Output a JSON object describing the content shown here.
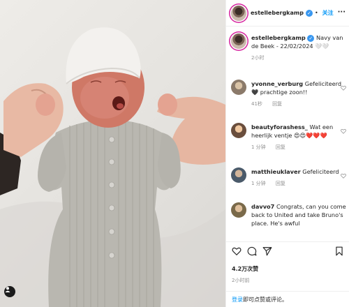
{
  "header": {
    "username": "estellebergkamp",
    "separator": "•",
    "follow_label": "关注",
    "more_label": "···"
  },
  "caption": {
    "username": "estellebergkamp",
    "text": "Navy van de Beek - 22/02/2024 🤍🤍",
    "time": "2小时"
  },
  "comments": [
    {
      "username": "yvonne_verburg",
      "text": "Gefeliciteerd 🖤 prachtige zoon!!",
      "time": "41秒",
      "reply": "回复"
    },
    {
      "username": "beautyforashess_",
      "text": "Wat een heerlijk ventje 😍😍❤️❤️❤️",
      "time": "1 分钟",
      "reply": "回复"
    },
    {
      "username": "matthieuklaver",
      "text": "Gefeliciteerd",
      "time": "1 分钟",
      "reply": "回复"
    },
    {
      "username": "davvo7",
      "text": "Congrats, can you come back to United and take Bruno's place. He's awful",
      "time": "",
      "reply": ""
    }
  ],
  "stats": {
    "likes": "4.2万次赞",
    "date": "2小时前"
  },
  "login": {
    "link_label": "登录",
    "rest_label": "即可点赞或评论。"
  },
  "colors": {
    "link": "#0095f6",
    "verified": "#3897f0",
    "story_ring": "#d6249f",
    "muted": "#8e8e8e"
  }
}
